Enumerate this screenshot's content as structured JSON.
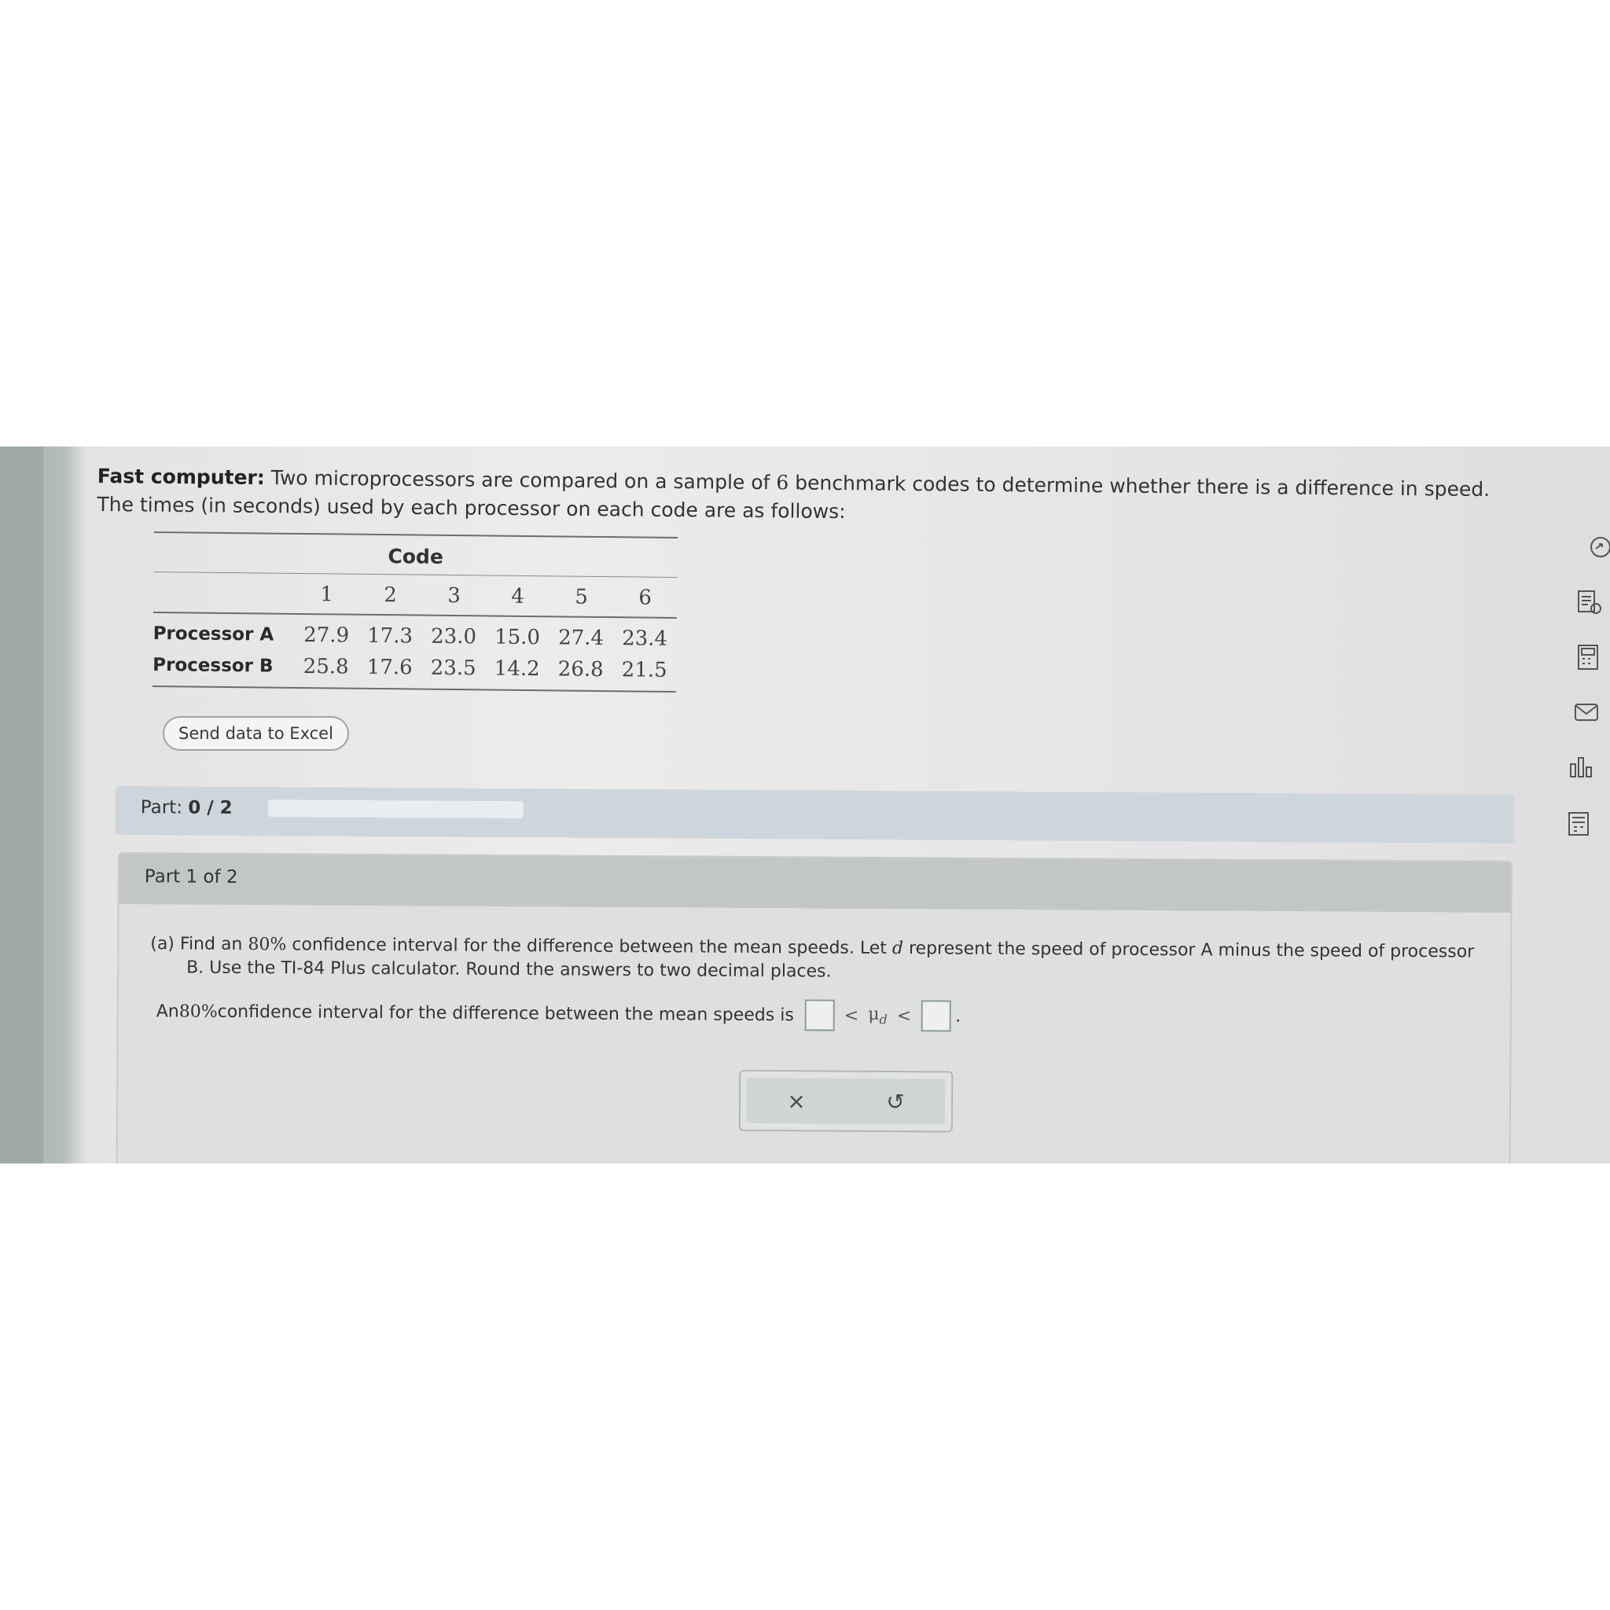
{
  "problem": {
    "title_bold": "Fast computer:",
    "intro_text": " Two microprocessors are compared on a sample of ",
    "sample_size": "6",
    "intro_text2": " benchmark codes to determine whether there is a difference in speed. The times (in seconds) used by each processor on each code are as follows:"
  },
  "table": {
    "header": "Code",
    "columns": [
      "1",
      "2",
      "3",
      "4",
      "5",
      "6"
    ],
    "rows": [
      {
        "label": "Processor A",
        "values": [
          "27.9",
          "17.3",
          "23.0",
          "15.0",
          "27.4",
          "23.4"
        ]
      },
      {
        "label": "Processor B",
        "values": [
          "25.8",
          "17.6",
          "23.5",
          "14.2",
          "26.8",
          "21.5"
        ]
      }
    ]
  },
  "excel_button": "Send data to Excel",
  "part_bar": {
    "label": "Part:",
    "progress": "0 / 2",
    "progress_fraction": 0
  },
  "part_panel": {
    "title": "Part 1 of 2",
    "q_prefix": "(a) Find an ",
    "q_pct": "80%",
    "q_mid": " confidence interval for the difference between the mean speeds. Let ",
    "q_var": "d",
    "q_end": " represent the speed of processor A minus the speed of processor",
    "q_line2": "B. Use the TI-84 Plus calculator. Round the answers to two decimal places.",
    "ans_prefix": "An ",
    "ans_pct": "80%",
    "ans_text": " confidence interval for the difference between the mean speeds is",
    "lt1": "<",
    "mu": "μ",
    "mu_sub": "d",
    "lt2": "<",
    "period": "."
  },
  "actions": {
    "clear": "×",
    "reset": "↺"
  },
  "toolbar_icons": [
    "share-icon",
    "notes-icon",
    "calculator-icon",
    "mail-icon",
    "chart-icon",
    "data-icon"
  ]
}
